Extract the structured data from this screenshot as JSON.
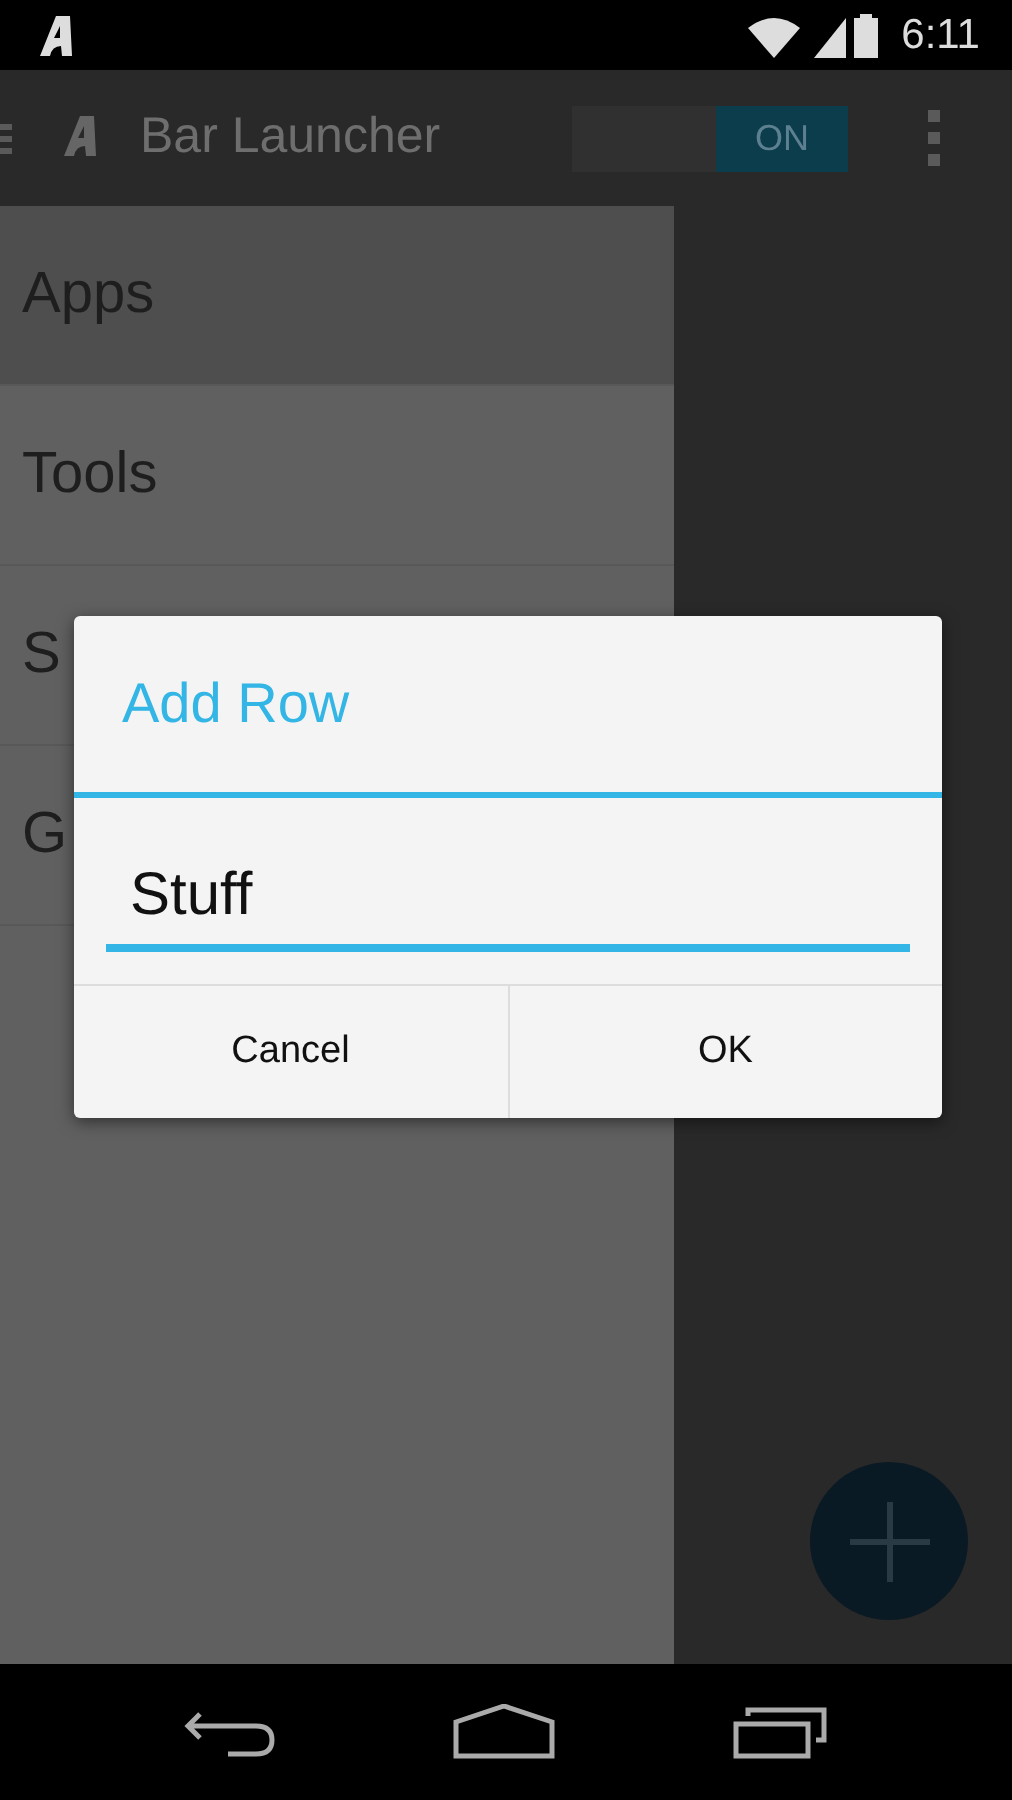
{
  "status_bar": {
    "time": "6:11"
  },
  "action_bar": {
    "title": "Bar Launcher",
    "toggle": {
      "label": "ON",
      "on": true
    }
  },
  "drawer": {
    "items": [
      {
        "label": "Apps",
        "selected": true
      },
      {
        "label": "Tools",
        "selected": false
      },
      {
        "label": "S",
        "selected": false
      },
      {
        "label": "G",
        "selected": false
      }
    ]
  },
  "dialog": {
    "title": "Add Row",
    "field": {
      "value": "Stuff"
    },
    "buttons": [
      "Cancel",
      "OK"
    ]
  }
}
